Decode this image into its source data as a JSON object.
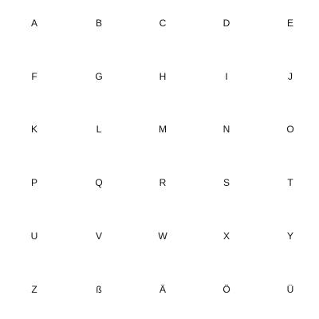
{
  "keyboard": {
    "rows": [
      [
        "A",
        "B",
        "C",
        "D",
        "E"
      ],
      [
        "F",
        "G",
        "H",
        "I",
        "J"
      ],
      [
        "K",
        "L",
        "M",
        "N",
        "O"
      ],
      [
        "P",
        "Q",
        "R",
        "S",
        "T"
      ],
      [
        "U",
        "V",
        "W",
        "X",
        "Y"
      ],
      [
        "Z",
        "ß",
        "Ä",
        "Ö",
        "Ü"
      ]
    ]
  }
}
